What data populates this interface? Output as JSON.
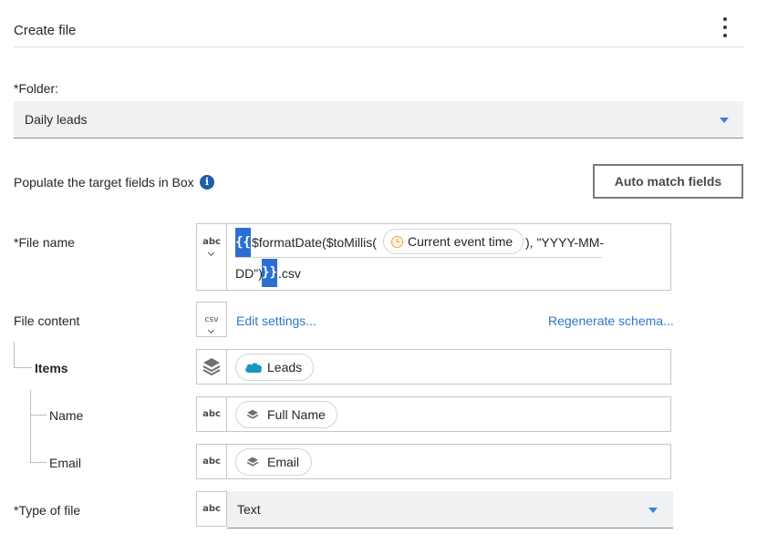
{
  "header": {
    "title": "Create file",
    "menu_icon": "kebab-menu-icon"
  },
  "folder": {
    "label": "*Folder:",
    "value": "Daily leads"
  },
  "populate": {
    "label": "Populate the target fields in Box",
    "info_icon": "info-icon",
    "auto_match_label": "Auto match fields"
  },
  "file_name": {
    "label": "*File name",
    "type": "abc",
    "open_brace": "{{",
    "close_brace": "}}",
    "expr_part1": "$formatDate($toMillis(",
    "pill_label": "Current event time",
    "expr_part2": "), \"YYYY-MM-",
    "expr_part3": "DD\")",
    "suffix": ".csv"
  },
  "file_content": {
    "label": "File content",
    "type": "csv",
    "edit_link": "Edit settings...",
    "regen_link": "Regenerate schema..."
  },
  "items": {
    "label": "Items",
    "type_icon": "layers-icon",
    "pill_label": "Leads",
    "pill_icon": "salesforce-cloud-icon"
  },
  "name": {
    "label": "Name",
    "type": "abc",
    "pill_label": "Full Name",
    "pill_icon": "layers-icon"
  },
  "email": {
    "label": "Email",
    "type": "abc",
    "pill_label": "Email",
    "pill_icon": "layers-icon"
  },
  "type_of_file": {
    "label": "*Type of file",
    "type": "abc",
    "value": "Text"
  },
  "colors": {
    "accent": "#2d6fd0",
    "link": "#2f78c8",
    "salesforce": "#1798c1",
    "pill_clock": "#e8a33a"
  }
}
